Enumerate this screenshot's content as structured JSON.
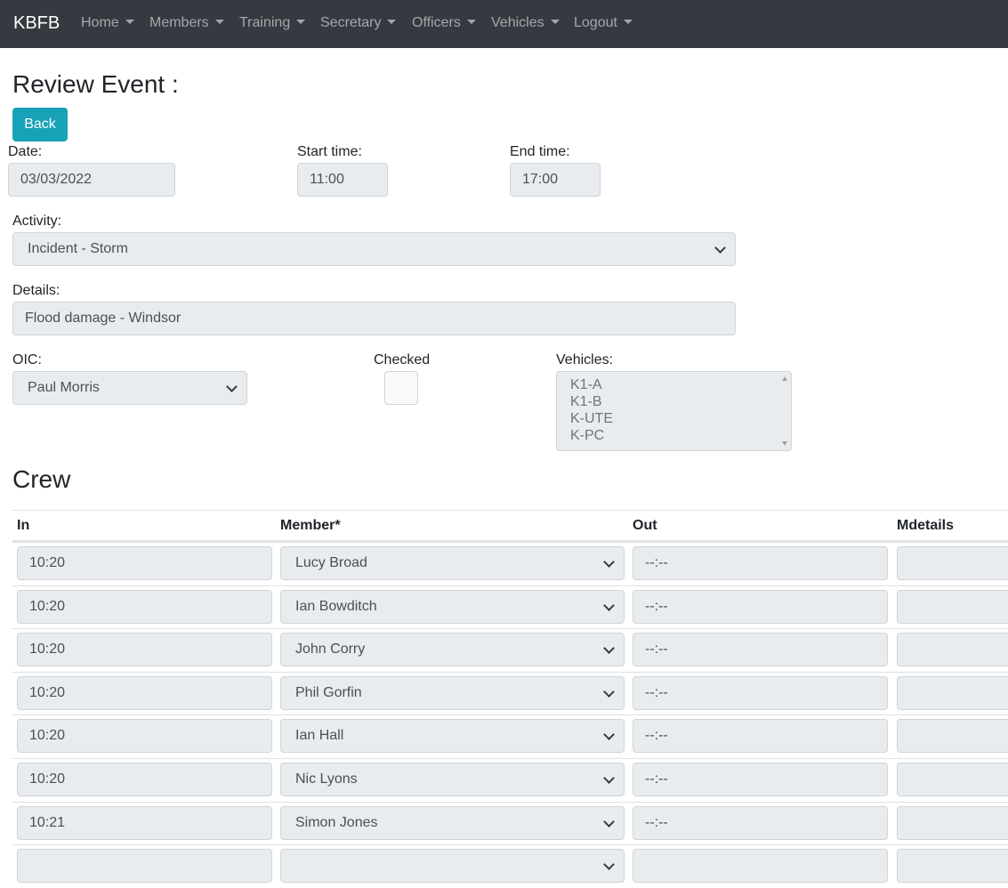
{
  "navbar": {
    "brand": "KBFB",
    "items": [
      "Home",
      "Members",
      "Training",
      "Secretary",
      "Officers",
      "Vehicles",
      "Logout"
    ]
  },
  "page": {
    "title": "Review Event :",
    "back_label": "Back"
  },
  "form": {
    "date_label": "Date:",
    "date_value": "03/03/2022",
    "start_label": "Start time:",
    "start_value": "11:00",
    "end_label": "End time:",
    "end_value": "17:00",
    "activity_label": "Activity:",
    "activity_value": "Incident - Storm",
    "details_label": "Details:",
    "details_value": "Flood damage - Windsor",
    "oic_label": "OIC:",
    "oic_value": "Paul Morris",
    "checked_label": "Checked",
    "vehicles_label": "Vehicles:",
    "vehicles_options": [
      "K1-A",
      "K1-B",
      "K-UTE",
      "K-PC"
    ]
  },
  "crew": {
    "title": "Crew",
    "headers": [
      "In",
      "Member*",
      "Out",
      "Mdetails"
    ],
    "rows": [
      {
        "in": "10:20",
        "member": "Lucy Broad",
        "out": "--:--",
        "mdetails": ""
      },
      {
        "in": "10:20",
        "member": "Ian Bowditch",
        "out": "--:--",
        "mdetails": ""
      },
      {
        "in": "10:20",
        "member": "John Corry",
        "out": "--:--",
        "mdetails": ""
      },
      {
        "in": "10:20",
        "member": "Phil Gorfin",
        "out": "--:--",
        "mdetails": ""
      },
      {
        "in": "10:20",
        "member": "Ian Hall",
        "out": "--:--",
        "mdetails": ""
      },
      {
        "in": "10:20",
        "member": "Nic Lyons",
        "out": "--:--",
        "mdetails": ""
      },
      {
        "in": "10:21",
        "member": "Simon Jones",
        "out": "--:--",
        "mdetails": ""
      },
      {
        "in": "",
        "member": "",
        "out": "",
        "mdetails": ""
      }
    ]
  },
  "colors": {
    "navbar": "#343a40",
    "back_button": "#17a2b8",
    "field_bg": "#e9ecef"
  }
}
